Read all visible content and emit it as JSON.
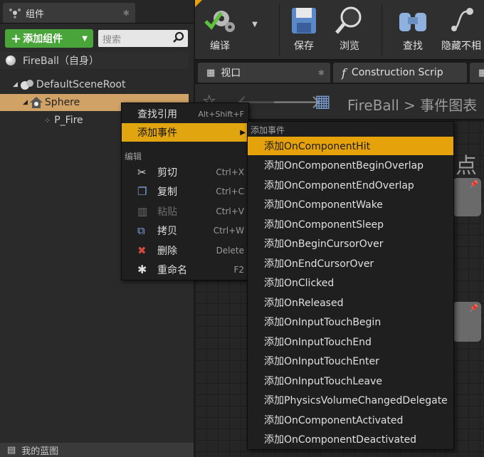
{
  "left_panel": {
    "tab_title": "组件",
    "add_component_label": "添加组件",
    "search_placeholder": "搜索",
    "self_item": "FireBall（自身）",
    "tree": {
      "root": "DefaultSceneRoot",
      "sphere": "Sphere",
      "fire": "P_Fire"
    },
    "bottom_tab": "我的蓝图"
  },
  "toolbar": {
    "compile": "编译",
    "save": "保存",
    "browse": "浏览",
    "find": "查找",
    "hide": "隐藏不相"
  },
  "tabs": {
    "viewport": "视口",
    "construction": "Construction Scrip"
  },
  "graph_header": {
    "breadcrumb_root": "FireBall",
    "breadcrumb_sep": ">",
    "breadcrumb_leaf": "事件图表"
  },
  "graph": {
    "partial_text": "点"
  },
  "context_menu": {
    "find_refs": "查找引用",
    "find_refs_shortcut": "Alt+Shift+F",
    "add_event": "添加事件",
    "edit_section": "编辑",
    "cut": "剪切",
    "cut_shortcut": "Ctrl+X",
    "copy": "复制",
    "copy_shortcut": "Ctrl+C",
    "paste": "粘贴",
    "paste_shortcut": "Ctrl+V",
    "duplicate": "拷贝",
    "duplicate_shortcut": "Ctrl+W",
    "delete": "删除",
    "delete_shortcut": "Delete",
    "rename": "重命名",
    "rename_shortcut": "F2"
  },
  "event_submenu": {
    "header": "添加事件",
    "items": [
      "添加OnComponentHit",
      "添加OnComponentBeginOverlap",
      "添加OnComponentEndOverlap",
      "添加OnComponentWake",
      "添加OnComponentSleep",
      "添加OnBeginCursorOver",
      "添加OnEndCursorOver",
      "添加OnClicked",
      "添加OnReleased",
      "添加OnInputTouchBegin",
      "添加OnInputTouchEnd",
      "添加OnInputTouchEnter",
      "添加OnInputTouchLeave",
      "添加PhysicsVolumeChangedDelegate",
      "添加OnComponentActivated",
      "添加OnComponentDeactivated"
    ]
  },
  "colors": {
    "highlight": "#e6a20b",
    "add_button": "#49a43a",
    "selected_row": "#d1a265"
  }
}
